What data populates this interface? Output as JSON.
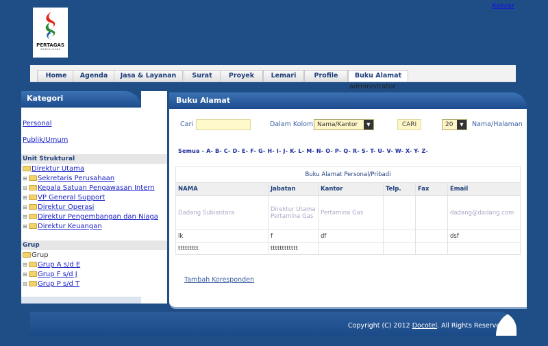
{
  "header": {
    "logout_label": "Keluar",
    "logo_text": "PERTAGAS",
    "logo_tagline": "WORLD CLASS"
  },
  "nav": {
    "tabs": [
      {
        "label": "Home"
      },
      {
        "label": "Agenda"
      },
      {
        "label": "Jasa & Layanan"
      },
      {
        "label": "Surat"
      },
      {
        "label": "Proyek"
      },
      {
        "label": "Lemari"
      },
      {
        "label": "Profile"
      },
      {
        "label": "Buku Alamat"
      }
    ],
    "username": "administrator"
  },
  "sidebar": {
    "title": "Kategori",
    "links": [
      "Personal",
      "Publik/Umum"
    ],
    "unit_title": "Unit Struktural",
    "unit_root": "Direktur Utama",
    "unit_items": [
      "Sekretaris Perusahaan",
      "Kepala Satuan Pengawasan Intern",
      "VP General Support",
      "Direktur Operasi",
      "Direktur Pengembangan dan Niaga",
      "Direktur Keuangan"
    ],
    "group_title": "Grup",
    "group_root": "Grup",
    "group_items": [
      "Grup A s/d E",
      "Grup F s/d J",
      "Grup P s/d T"
    ]
  },
  "main": {
    "title": "Buku Alamat",
    "search_label": "Cari",
    "search_value": "",
    "column_label": "Dalam Kolom",
    "column_selected": "Nama/Kantor",
    "cari_button": "CARI",
    "per_page_selected": "20",
    "per_page_label": "Nama/Halaman",
    "alphabet": "Semua - A- B- C- D- E- F- G- H- I- J- K- L- M- N- O- P- Q- R- S- T- U- V- W- X- Y- Z-",
    "table_caption": "Buku Alamat Personal/Pribadi",
    "columns": [
      "NAMA",
      "Jabatan",
      "Kantor",
      "Telp.",
      "Fax",
      "Email"
    ],
    "rows": [
      [
        "Dadang Subiantara",
        "Direktur Utama Pertamina Gas",
        "Pertamina Gas",
        "",
        "",
        "dadang@dadang.com"
      ],
      [
        "lk",
        "f",
        "df",
        "",
        "",
        "dsf"
      ],
      [
        "ttttttttt",
        "tttttttttttt",
        "",
        "",
        "",
        ""
      ]
    ],
    "add_link": "Tambah Koresponden"
  },
  "footer": {
    "copyright_prefix": "Copyright (C) 2012",
    "company": "Docotel",
    "rights": ". All Rights Reserved."
  },
  "colors": {
    "background": "#1f4e87",
    "header_gradient_top": "#3b72b4",
    "link": "#1a22c8",
    "input_fill": "#fff9cc"
  }
}
